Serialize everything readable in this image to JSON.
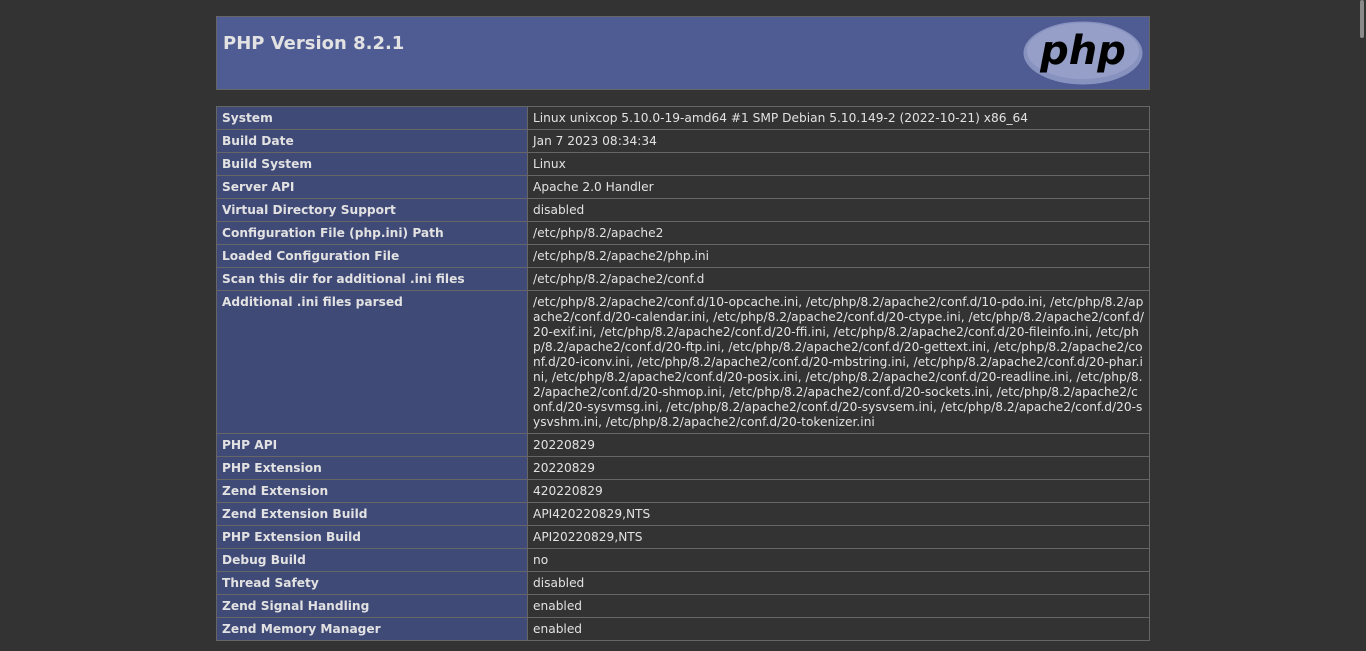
{
  "header": {
    "title": "PHP Version 8.2.1",
    "logo_text": "php"
  },
  "rows": [
    {
      "key": "System",
      "value": "Linux unixcop 5.10.0-19-amd64 #1 SMP Debian 5.10.149-2 (2022-10-21) x86_64"
    },
    {
      "key": "Build Date",
      "value": "Jan 7 2023 08:34:34"
    },
    {
      "key": "Build System",
      "value": "Linux"
    },
    {
      "key": "Server API",
      "value": "Apache 2.0 Handler"
    },
    {
      "key": "Virtual Directory Support",
      "value": "disabled"
    },
    {
      "key": "Configuration File (php.ini) Path",
      "value": "/etc/php/8.2/apache2"
    },
    {
      "key": "Loaded Configuration File",
      "value": "/etc/php/8.2/apache2/php.ini"
    },
    {
      "key": "Scan this dir for additional .ini files",
      "value": "/etc/php/8.2/apache2/conf.d"
    },
    {
      "key": "Additional .ini files parsed",
      "value": "/etc/php/8.2/apache2/conf.d/10-opcache.ini, /etc/php/8.2/apache2/conf.d/10-pdo.ini, /etc/php/8.2/apache2/conf.d/20-calendar.ini, /etc/php/8.2/apache2/conf.d/20-ctype.ini, /etc/php/8.2/apache2/conf.d/20-exif.ini, /etc/php/8.2/apache2/conf.d/20-ffi.ini, /etc/php/8.2/apache2/conf.d/20-fileinfo.ini, /etc/php/8.2/apache2/conf.d/20-ftp.ini, /etc/php/8.2/apache2/conf.d/20-gettext.ini, /etc/php/8.2/apache2/conf.d/20-iconv.ini, /etc/php/8.2/apache2/conf.d/20-mbstring.ini, /etc/php/8.2/apache2/conf.d/20-phar.ini, /etc/php/8.2/apache2/conf.d/20-posix.ini, /etc/php/8.2/apache2/conf.d/20-readline.ini, /etc/php/8.2/apache2/conf.d/20-shmop.ini, /etc/php/8.2/apache2/conf.d/20-sockets.ini, /etc/php/8.2/apache2/conf.d/20-sysvmsg.ini, /etc/php/8.2/apache2/conf.d/20-sysvsem.ini, /etc/php/8.2/apache2/conf.d/20-sysvshm.ini, /etc/php/8.2/apache2/conf.d/20-tokenizer.ini"
    },
    {
      "key": "PHP API",
      "value": "20220829"
    },
    {
      "key": "PHP Extension",
      "value": "20220829"
    },
    {
      "key": "Zend Extension",
      "value": "420220829"
    },
    {
      "key": "Zend Extension Build",
      "value": "API420220829,NTS"
    },
    {
      "key": "PHP Extension Build",
      "value": "API20220829,NTS"
    },
    {
      "key": "Debug Build",
      "value": "no"
    },
    {
      "key": "Thread Safety",
      "value": "disabled"
    },
    {
      "key": "Zend Signal Handling",
      "value": "enabled"
    },
    {
      "key": "Zend Memory Manager",
      "value": "enabled"
    }
  ],
  "colors": {
    "background": "#333333",
    "header_bg": "#4f5b93",
    "key_cell_bg": "#404a77",
    "border": "#666666",
    "text": "#e2e2e2"
  }
}
